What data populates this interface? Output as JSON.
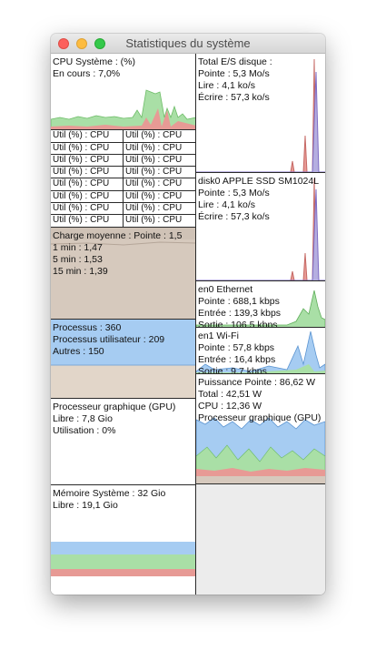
{
  "window": {
    "title": "Statistiques du système"
  },
  "cpu": {
    "title": "CPU Système : (%)",
    "current": "En cours : 7,0%"
  },
  "cpu_cores": {
    "label": "Util (%) : CPU"
  },
  "load": {
    "title": "Charge moyenne : Pointe : 1,5",
    "min1": "1 min : 1,47",
    "min5": "5 min : 1,53",
    "min15": "15 min : 1,39"
  },
  "processes": {
    "total": "Processus : 360",
    "user": "Processus utilisateur : 209",
    "others": "Autres : 150"
  },
  "gpu": {
    "title": "Processeur graphique (GPU)",
    "free": "Libre : 7,8 Gio",
    "usage": "Utilisation : 0%"
  },
  "memory": {
    "title": "Mémoire Système : 32 Gio",
    "free": "Libre : 19,1 Gio"
  },
  "disk_total": {
    "title": "Total E/S disque :",
    "peak": "Pointe : 5,3 Mo/s",
    "read": "Lire : 4,1 ko/s",
    "write": "Écrire : 57,3 ko/s"
  },
  "disk0": {
    "title": "disk0 APPLE SSD SM1024L",
    "peak": "Pointe : 5,3 Mo/s",
    "read": "Lire : 4,1 ko/s",
    "write": "Écrire : 57,3 ko/s"
  },
  "en0": {
    "title": "en0 Ethernet",
    "peak": "Pointe : 688,1 kbps",
    "in": "Entrée : 139,3 kbps",
    "out": "Sortie : 106,5 kbps"
  },
  "en1": {
    "title": "en1 Wi-Fi",
    "peak": "Pointe : 57,8 kbps",
    "in": "Entrée : 16,4 kbps",
    "out": "Sortie : 9,7 kbps"
  },
  "power": {
    "title": "Puissance Pointe : 86,62 W",
    "total": "Total : 42,51 W",
    "cpu": "CPU : 12,36 W",
    "gpu": "Processeur graphique (GPU)"
  },
  "colors": {
    "green": "#a9dfa6",
    "red": "#e79a95",
    "blue": "#a6ccf2",
    "tan": "#d6c9bd",
    "purple": "#7d6bc4"
  }
}
